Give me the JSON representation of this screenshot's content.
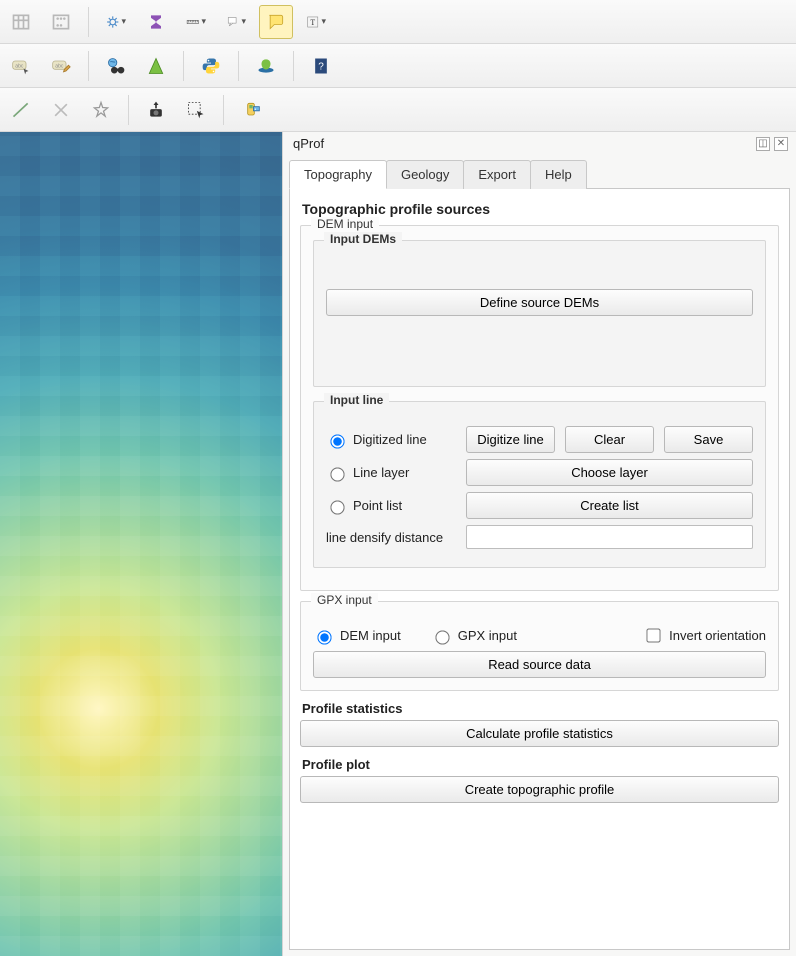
{
  "toolbar1": {
    "icons": [
      "table-icon",
      "abacus-icon",
      "gear-icon",
      "sigma-icon",
      "ruler-icon",
      "map-tips-dd-icon",
      "annotation-active-icon",
      "text-dd-icon"
    ]
  },
  "toolbar2": {
    "icons": [
      "abc-select-icon",
      "abc-edit-icon",
      "binoculars-globe-icon",
      "grass-icon",
      "python-icon",
      "leaf-icon",
      "help-book-icon"
    ]
  },
  "toolbar3": {
    "icons": [
      "line-icon",
      "cross-icon",
      "star-move-icon",
      "camera-up-icon",
      "select-rect-icon",
      "gps-icon"
    ]
  },
  "panel": {
    "title": "qProf",
    "tabs": [
      {
        "id": "topography",
        "label": "Topography",
        "active": true
      },
      {
        "id": "geology",
        "label": "Geology",
        "active": false
      },
      {
        "id": "export",
        "label": "Export",
        "active": false
      },
      {
        "id": "help",
        "label": "Help",
        "active": false
      }
    ],
    "section_heading": "Topographic profile sources",
    "dem_input_label": "DEM input",
    "input_dems_label": "Input DEMs",
    "define_dems_btn": "Define source DEMs",
    "input_line_label": "Input line",
    "line_options": {
      "digitized": "Digitized line",
      "line_layer": "Line layer",
      "point_list": "Point list"
    },
    "btns": {
      "digitize": "Digitize line",
      "clear": "Clear",
      "save": "Save",
      "choose_layer": "Choose layer",
      "create_list": "Create list"
    },
    "densify_label": "line densify distance",
    "densify_value": "",
    "gpx_input_label": "GPX input",
    "source_selector": {
      "dem": "DEM input",
      "gpx": "GPX input",
      "invert": "Invert orientation"
    },
    "read_btn": "Read source data",
    "stats_heading": "Profile statistics",
    "calc_stats_btn": "Calculate profile statistics",
    "plot_heading": "Profile plot",
    "create_profile_btn": "Create topographic profile"
  }
}
